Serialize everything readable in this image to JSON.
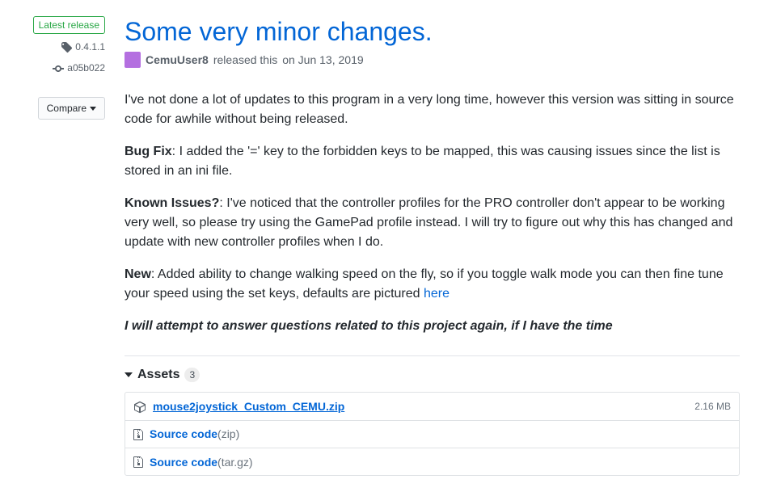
{
  "sidebar": {
    "latest_label": "Latest release",
    "tag": "0.4.1.1",
    "commit": "a05b022",
    "compare_label": "Compare"
  },
  "release": {
    "title": "Some very minor changes.",
    "author": "CemuUser8",
    "released_prefix": " released this ",
    "released_date": "on Jun 13, 2019"
  },
  "body": {
    "p1": "I've not done a lot of updates to this program in a very long time, however this version was sitting in source code for awhile without being released.",
    "p2_label": "Bug Fix",
    "p2_text": ": I added the '=' key to the forbidden keys to be mapped, this was causing issues since the list is stored in an ini file.",
    "p3_label": "Known Issues?",
    "p3_text": ": I've noticed that the controller profiles for the PRO controller don't appear to be working very well, so please try using the GamePad profile instead. I will try to figure out why this has changed and update with new controller profiles when I do.",
    "p4_label": "New",
    "p4_text": ": Added ability to change walking speed on the fly, so if you toggle walk mode you can then fine tune your speed using the set keys, defaults are pictured ",
    "p4_link": "here",
    "p5_em": "I will attempt to answer questions related to this project again, if I have the time"
  },
  "assets": {
    "header_label": "Assets",
    "count": "3",
    "items": [
      {
        "name": "mouse2joystick_Custom_CEMU.zip",
        "size": "2.16 MB",
        "primary": true
      },
      {
        "name": "Source code",
        "suffix": " (zip)"
      },
      {
        "name": "Source code",
        "suffix": " (tar.gz)"
      }
    ]
  }
}
